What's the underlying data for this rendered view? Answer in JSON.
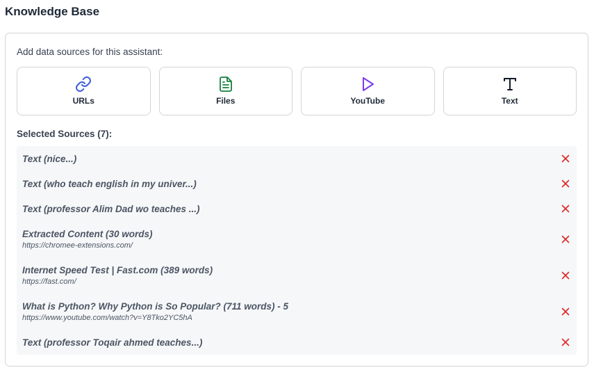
{
  "header": {
    "title": "Knowledge Base"
  },
  "panel": {
    "hint": "Add data sources for this assistant:"
  },
  "source_buttons": [
    {
      "label": "URLs",
      "icon": "link-icon",
      "color": "#3b5bdb"
    },
    {
      "label": "Files",
      "icon": "file-icon",
      "color": "#15803d"
    },
    {
      "label": "YouTube",
      "icon": "play-icon",
      "color": "#7c3aed"
    },
    {
      "label": "Text",
      "icon": "text-icon",
      "color": "#111827"
    }
  ],
  "selected": {
    "title": "Selected Sources (7):",
    "items": [
      {
        "name": "Text (nice...)",
        "url": ""
      },
      {
        "name": "Text (who teach english in my univer...)",
        "url": ""
      },
      {
        "name": "Text (professor Alim Dad wo teaches ...)",
        "url": ""
      },
      {
        "name": "Extracted Content (30 words)",
        "url": "https://chromee-extensions.com/"
      },
      {
        "name": "Internet Speed Test | Fast.com (389 words)",
        "url": "https://fast.com/"
      },
      {
        "name": "What is Python? Why Python is So Popular? (711 words) - 5",
        "url": "https://www.youtube.com/watch?v=Y8Tko2YC5hA"
      },
      {
        "name": "Text (professor Toqair ahmed teaches...)",
        "url": ""
      }
    ]
  },
  "colors": {
    "remove": "#dc2626",
    "row_bg": "#f6f7f9",
    "border": "#d4d4d8"
  }
}
